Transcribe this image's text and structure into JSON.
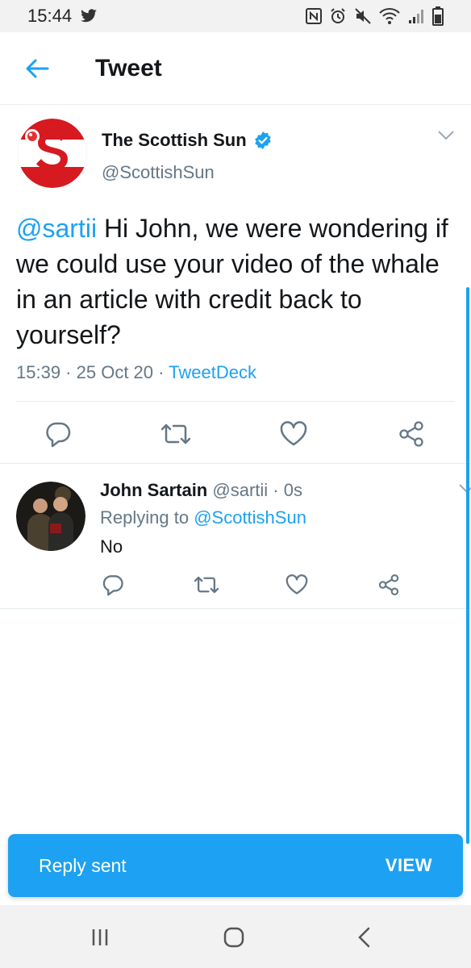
{
  "status_bar": {
    "time": "15:44"
  },
  "app_bar": {
    "title": "Tweet"
  },
  "tweet": {
    "author_name": "The Scottish Sun",
    "author_handle": "@ScottishSun",
    "mention": "@sartii",
    "text_rest": " Hi John, we were wondering if we could use your video of the whale in an article with credit back to yourself?",
    "time": "15:39",
    "date": "25 Oct 20",
    "source": "TweetDeck"
  },
  "reply": {
    "author_name": "John Sartain",
    "author_handle": "@sartii",
    "age": "0s",
    "replying_label": "Replying to",
    "replying_to": "@ScottishSun",
    "text": "No"
  },
  "toast": {
    "message": "Reply sent",
    "action": "VIEW"
  },
  "colors": {
    "accent": "#1da1f2",
    "secondary_text": "#657786",
    "brand_red": "#d71920"
  },
  "icons": [
    "twitter-icon",
    "nfc-icon",
    "alarm-icon",
    "mute-icon",
    "wifi-icon",
    "signal-icon",
    "battery-icon",
    "back-arrow-icon",
    "verified-icon",
    "chevron-down-icon",
    "reply-icon",
    "retweet-icon",
    "like-icon",
    "share-icon",
    "recents-icon",
    "home-icon",
    "back-icon"
  ]
}
